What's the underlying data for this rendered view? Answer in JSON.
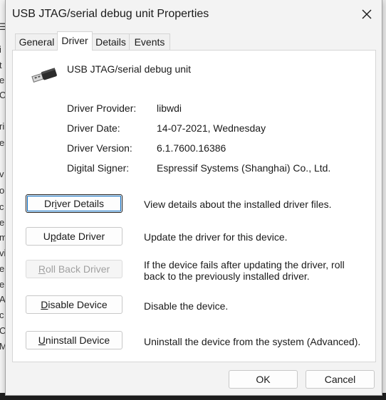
{
  "window": {
    "title": "USB JTAG/serial debug unit Properties",
    "close_icon": "close-icon"
  },
  "tabs": [
    {
      "label": "General",
      "active": false
    },
    {
      "label": "Driver",
      "active": true
    },
    {
      "label": "Details",
      "active": false
    },
    {
      "label": "Events",
      "active": false
    }
  ],
  "device": {
    "icon": "usb-plug-icon",
    "name": "USB JTAG/serial debug unit"
  },
  "driver_info": [
    {
      "label": "Driver Provider:",
      "value": "libwdi"
    },
    {
      "label": "Driver Date:",
      "value": "14-07-2021, Wednesday"
    },
    {
      "label": "Driver Version:",
      "value": "6.1.7600.16386"
    },
    {
      "label": "Digital Signer:",
      "value": "Espressif Systems (Shanghai) Co., Ltd."
    }
  ],
  "actions": [
    {
      "label_pre": "Dr",
      "label_ul": "i",
      "label_post": "ver Details",
      "description": "View details about the installed driver files.",
      "enabled": true,
      "focused": true
    },
    {
      "label_pre": "U",
      "label_ul": "p",
      "label_post": "date Driver",
      "description": "Update the driver for this device.",
      "enabled": true,
      "focused": false
    },
    {
      "label_pre": "",
      "label_ul": "R",
      "label_post": "oll Back Driver",
      "description": "If the device fails after updating the driver, roll back to the previously installed driver.",
      "enabled": false,
      "focused": false
    },
    {
      "label_pre": "",
      "label_ul": "D",
      "label_post": "isable Device",
      "description": "Disable the device.",
      "enabled": true,
      "focused": false
    },
    {
      "label_pre": "",
      "label_ul": "U",
      "label_post": "ninstall Device",
      "description": "Uninstall the device from the system (Advanced).",
      "enabled": true,
      "focused": false
    }
  ],
  "footer": {
    "ok_label": "OK",
    "cancel_label": "Cancel"
  },
  "background_fragments": [
    "☰",
    "i",
    "t",
    "e",
    "C",
    "ri",
    "es",
    "v",
    "o",
    "c",
    "e",
    "m",
    "vi",
    "e",
    "e",
    "A",
    "c",
    "C",
    "M"
  ]
}
